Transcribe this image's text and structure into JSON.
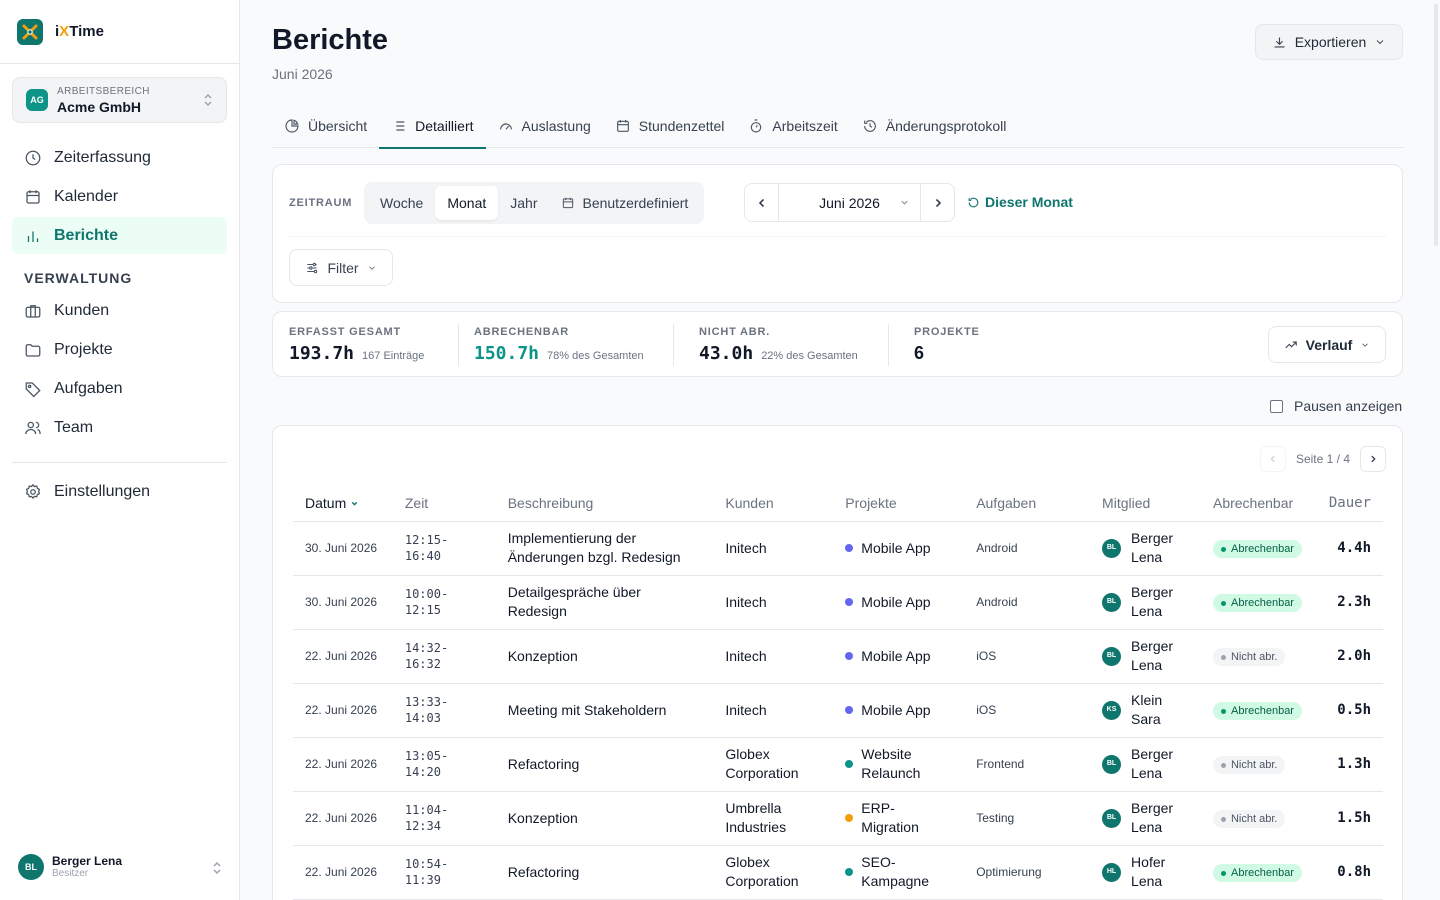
{
  "app": {
    "name_prefix": "i",
    "name_x": "X",
    "name_suffix": "Time"
  },
  "workspace": {
    "badge": "AG",
    "label": "Arbeitsbereich",
    "name": "Acme GmbH"
  },
  "sidebar": {
    "main_items": [
      {
        "label": "Zeiterfassung",
        "icon": "clock-icon"
      },
      {
        "label": "Kalender",
        "icon": "calendar-icon"
      },
      {
        "label": "Berichte",
        "icon": "bar-chart-icon",
        "active": true
      }
    ],
    "section_label": "VERWALTUNG",
    "admin_items": [
      {
        "label": "Kunden",
        "icon": "briefcase-icon"
      },
      {
        "label": "Projekte",
        "icon": "folder-icon"
      },
      {
        "label": "Aufgaben",
        "icon": "tag-icon"
      },
      {
        "label": "Team",
        "icon": "users-icon"
      }
    ],
    "settings_label": "Einstellungen"
  },
  "user": {
    "initials": "BL",
    "name": "Berger Lena",
    "role": "Besitzer"
  },
  "header": {
    "title": "Berichte",
    "subtitle": "Juni 2026",
    "export_label": "Exportieren"
  },
  "tabs": [
    {
      "label": "Übersicht",
      "icon": "pie-chart-icon"
    },
    {
      "label": "Detailliert",
      "icon": "list-icon",
      "active": true
    },
    {
      "label": "Auslastung",
      "icon": "gauge-icon"
    },
    {
      "label": "Stundenzettel",
      "icon": "calendar-icon"
    },
    {
      "label": "Arbeitszeit",
      "icon": "stopwatch-icon"
    },
    {
      "label": "Änderungsprotokoll",
      "icon": "history-icon"
    }
  ],
  "filters": {
    "period_label": "ZEITRAUM",
    "segments": [
      "Woche",
      "Monat",
      "Jahr",
      "Benutzerdefiniert"
    ],
    "active_segment": "Monat",
    "current_period": "Juni 2026",
    "this_month_label": "Dieser Monat",
    "filter_label": "Filter"
  },
  "stats": {
    "total": {
      "label": "ERFASST GESAMT",
      "value": "193.7h",
      "sub": "167 Einträge"
    },
    "billable": {
      "label": "ABRECHENBAR",
      "value": "150.7h",
      "sub": "78% des Gesamten"
    },
    "non_billable": {
      "label": "NICHT ABR.",
      "value": "43.0h",
      "sub": "22% des Gesamten"
    },
    "projects": {
      "label": "PROJEKTE",
      "value": "6"
    },
    "trend_label": "Verlauf"
  },
  "show_breaks_label": "Pausen anzeigen",
  "pagination": {
    "text": "Seite 1 / 4"
  },
  "table": {
    "headers": {
      "date": "Datum",
      "time": "Zeit",
      "description": "Beschreibung",
      "client": "Kunden",
      "project": "Projekte",
      "task": "Aufgaben",
      "member": "Mitglied",
      "billable": "Abrechenbar",
      "duration": "Dauer"
    },
    "rows": [
      {
        "date": "30. Juni 2026",
        "time": "12:15-16:40",
        "description": "Implementierung der Änderungen bzgl. Redesign",
        "client": "Initech",
        "project": "Mobile App",
        "project_color": "#6366f1",
        "task": "Android",
        "member_initials": "BL",
        "member": "Berger Lena",
        "billable": "Abrechenbar",
        "billable_ok": true,
        "duration": "4.4h"
      },
      {
        "date": "30. Juni 2026",
        "time": "10:00-12:15",
        "description": "Detailgespräche über Redesign",
        "client": "Initech",
        "project": "Mobile App",
        "project_color": "#6366f1",
        "task": "Android",
        "member_initials": "BL",
        "member": "Berger Lena",
        "billable": "Abrechenbar",
        "billable_ok": true,
        "duration": "2.3h"
      },
      {
        "date": "22. Juni 2026",
        "time": "14:32-16:32",
        "description": "Konzeption",
        "client": "Initech",
        "project": "Mobile App",
        "project_color": "#6366f1",
        "task": "iOS",
        "member_initials": "BL",
        "member": "Berger Lena",
        "billable": "Nicht abr.",
        "billable_ok": false,
        "duration": "2.0h"
      },
      {
        "date": "22. Juni 2026",
        "time": "13:33-14:03",
        "description": "Meeting mit Stakeholdern",
        "client": "Initech",
        "project": "Mobile App",
        "project_color": "#6366f1",
        "task": "iOS",
        "member_initials": "KS",
        "member": "Klein Sara",
        "billable": "Abrechenbar",
        "billable_ok": true,
        "duration": "0.5h"
      },
      {
        "date": "22. Juni 2026",
        "time": "13:05-14:20",
        "description": "Refactoring",
        "client": "Globex Corporation",
        "project": "Website Relaunch",
        "project_color": "#0d9488",
        "task": "Frontend",
        "member_initials": "BL",
        "member": "Berger Lena",
        "billable": "Nicht abr.",
        "billable_ok": false,
        "duration": "1.3h"
      },
      {
        "date": "22. Juni 2026",
        "time": "11:04-12:34",
        "description": "Konzeption",
        "client": "Umbrella Industries",
        "project": "ERP-Migration",
        "project_color": "#f59e0b",
        "task": "Testing",
        "member_initials": "BL",
        "member": "Berger Lena",
        "billable": "Nicht abr.",
        "billable_ok": false,
        "duration": "1.5h"
      },
      {
        "date": "22. Juni 2026",
        "time": "10:54-11:39",
        "description": "Refactoring",
        "client": "Globex Corporation",
        "project": "SEO-Kampagne",
        "project_color": "#0d9488",
        "task": "Optimierung",
        "member_initials": "HL",
        "member": "Hofer Lena",
        "billable": "Abrechenbar",
        "billable_ok": true,
        "duration": "0.8h"
      }
    ]
  },
  "colors": {
    "accent": "#0f766e",
    "accent_light": "#ecfdf5",
    "billable_green": "#0d9488"
  }
}
